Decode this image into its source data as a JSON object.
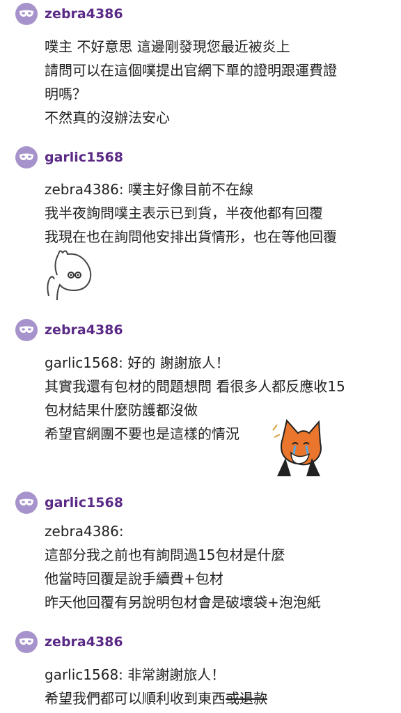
{
  "colors": {
    "avatar": "#a793cb",
    "username": "#5a2a86",
    "text": "#222222",
    "background": "#ffffff"
  },
  "comments": [
    {
      "user": "zebra4386",
      "avatar_icon": "mask-icon",
      "lines": [
        "噗主 不好意思 這邊剛發現您最近被炎上",
        "請問可以在這個噗提出官網下單的證明跟運費證",
        "明嗎？",
        "不然真的沒辦法安心"
      ]
    },
    {
      "user": "garlic1568",
      "avatar_icon": "mask-icon",
      "lines": [
        "zebra4386: 噗主好像目前不在線",
        "我半夜詢問噗主表示已到貨，半夜他都有回覆",
        "我現在也在詢問他安排出貨情形，也在等他回覆"
      ],
      "sticker": "moomin-sticker"
    },
    {
      "user": "zebra4386",
      "avatar_icon": "mask-icon",
      "lines": [
        "garlic1568: 好的 謝謝旅人！",
        "其實我還有包材的問題想問 看很多人都反應收15",
        "包材結果什麼防護都沒做",
        "希望官網團不要也是這樣的情況"
      ],
      "sticker": "crying-fox-sticker"
    },
    {
      "user": "garlic1568",
      "avatar_icon": "mask-icon",
      "lines": [
        "zebra4386:",
        "這部分我之前也有詢問過15包材是什麼",
        "他當時回覆是說手續費+包材",
        "昨天他回覆有另說明包材會是破壞袋+泡泡紙"
      ]
    },
    {
      "user": "zebra4386",
      "avatar_icon": "mask-icon",
      "lines": [
        "garlic1568: 非常謝謝旅人！",
        "希望我們都可以順利收到東西"
      ],
      "struck_text": "或退款"
    }
  ]
}
